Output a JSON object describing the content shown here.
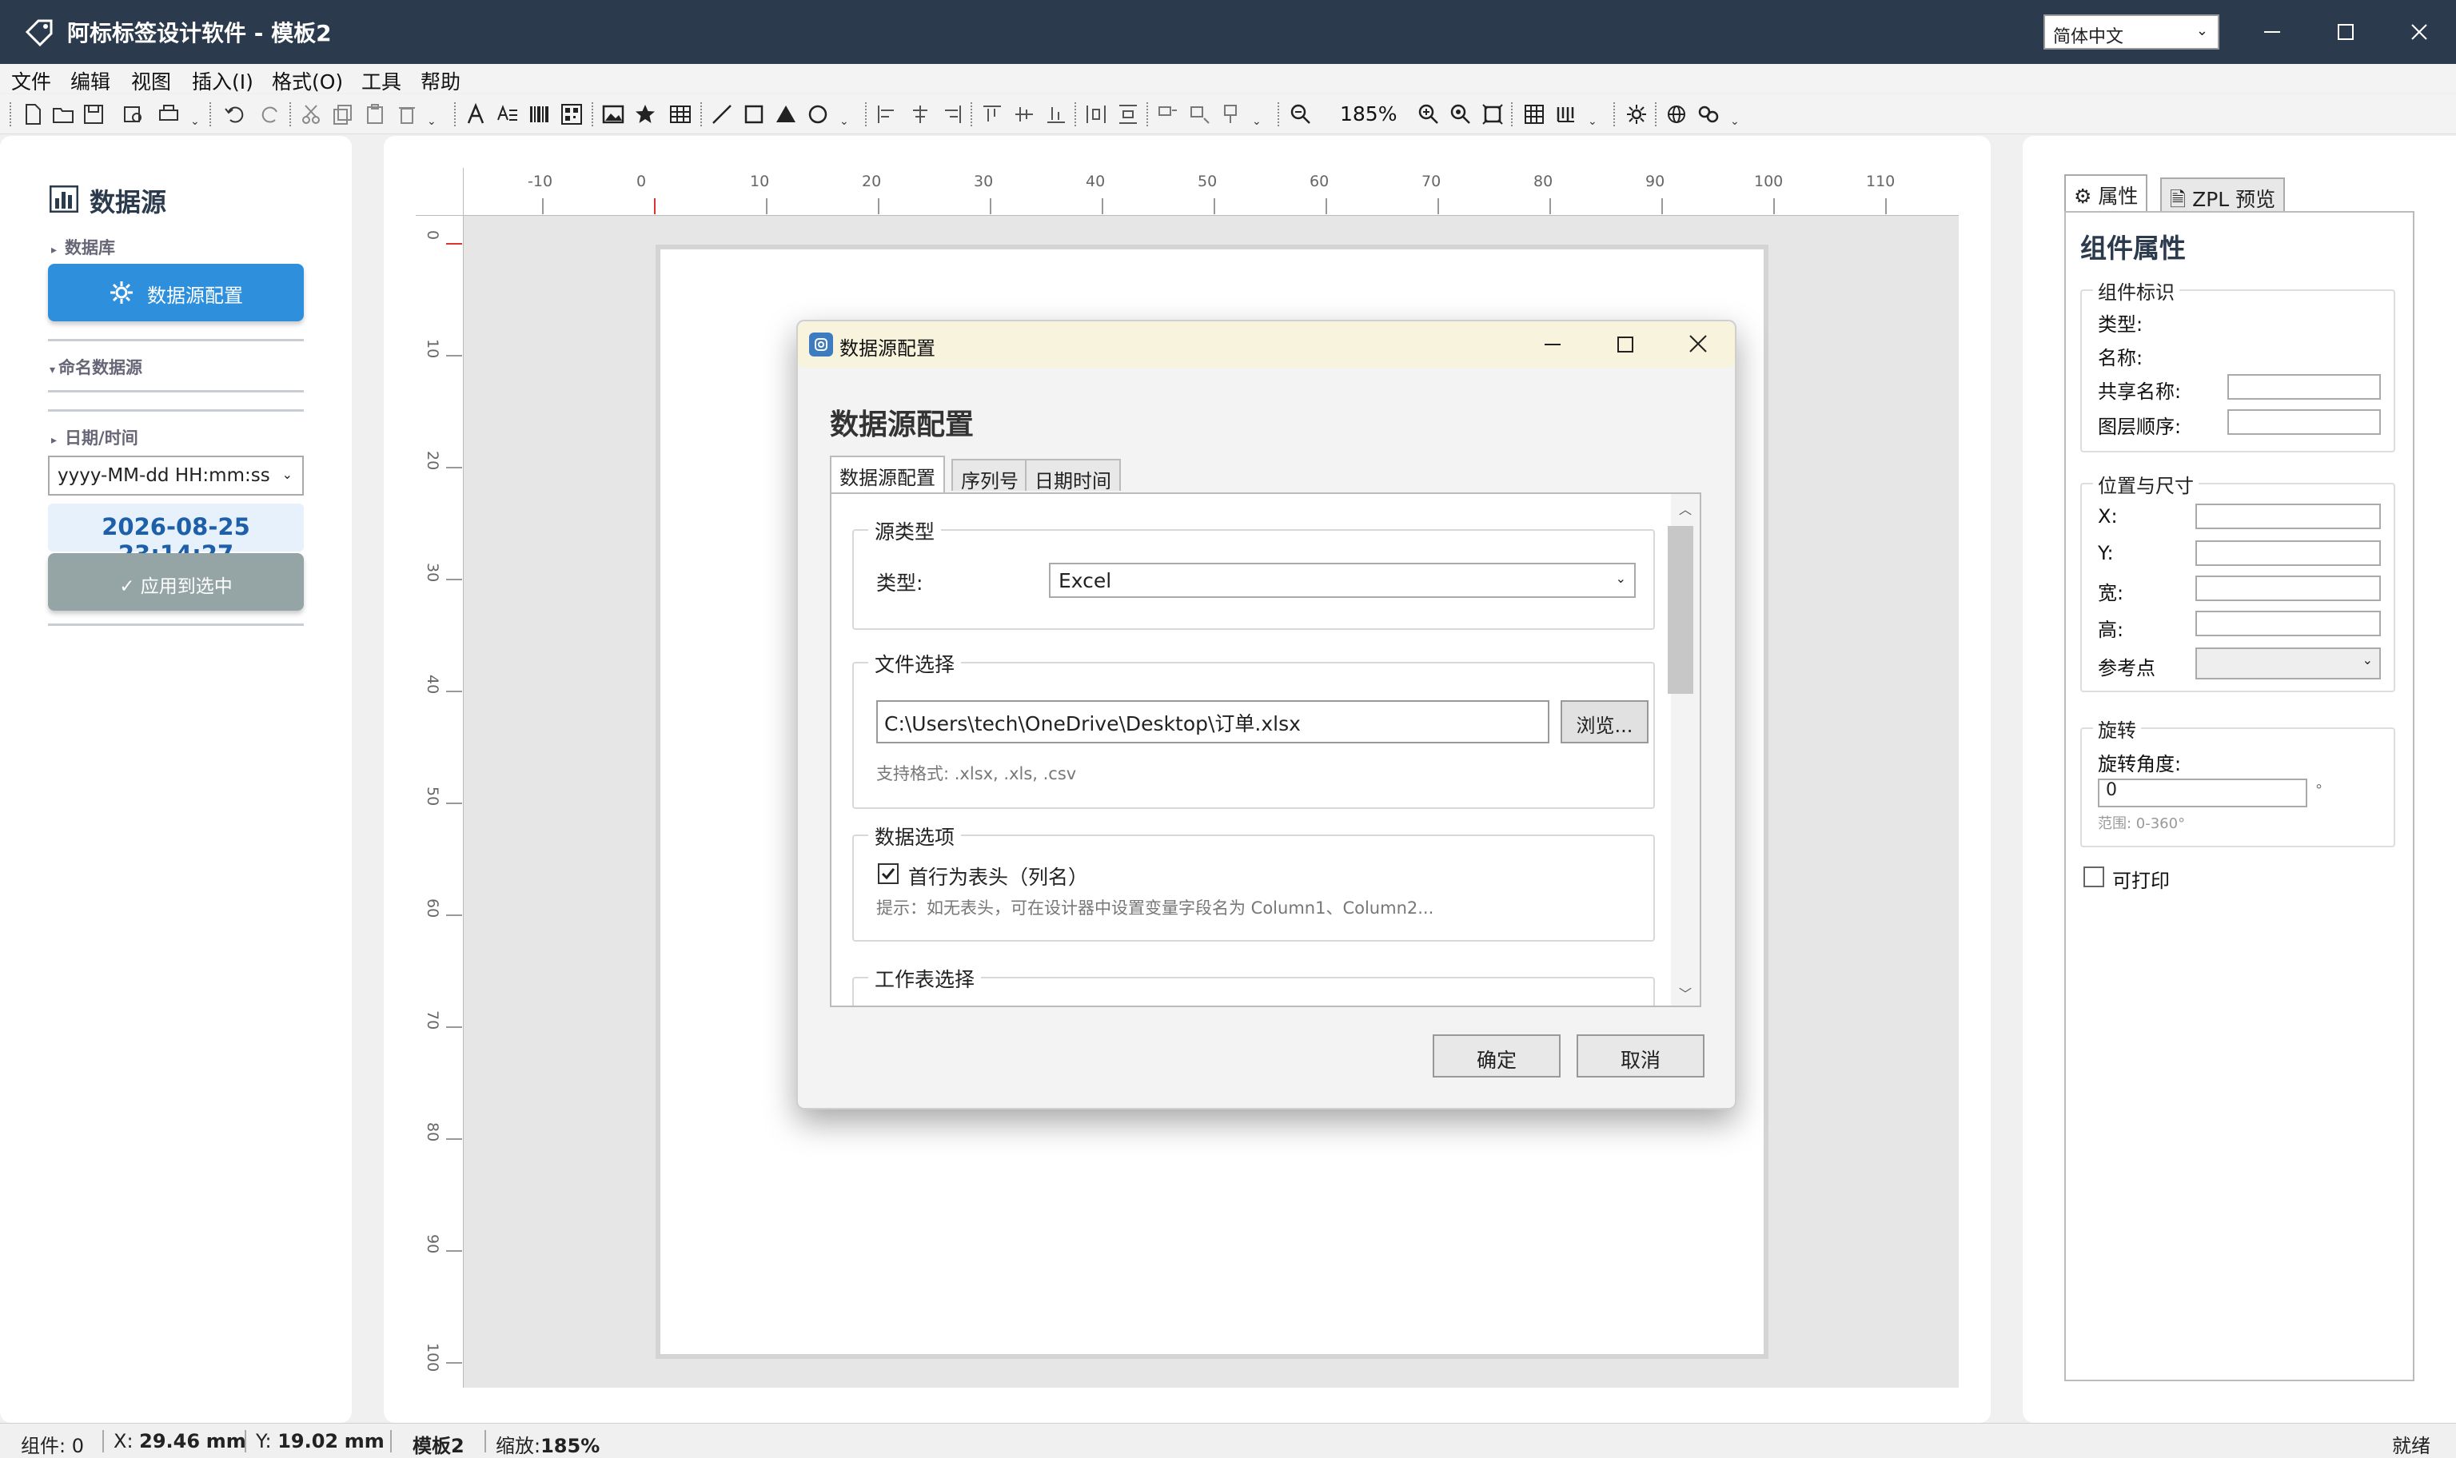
{
  "window": {
    "title": "阿标标签设计软件 - 模板2",
    "language": "简体中文"
  },
  "menu": [
    "文件",
    "编辑",
    "视图",
    "插入(I)",
    "格式(O)",
    "工具",
    "帮助"
  ],
  "toolbar": {
    "zoom": "185%"
  },
  "left_panel": {
    "title": "数据源",
    "section_database": "数据库",
    "ds_button": "数据源配置",
    "section_named": "命名数据源",
    "section_datetime": "日期/时间",
    "datetime_format": "yyyy-MM-dd HH:mm:ss",
    "datetime_value": "2026-08-25 23:14:27",
    "apply_button": "✓ 应用到选中"
  },
  "ruler": {
    "top_labels": [
      "-10",
      "0",
      "10",
      "20",
      "30",
      "40",
      "50",
      "60",
      "70",
      "80",
      "90",
      "100",
      "110"
    ],
    "left_labels": [
      "0",
      "10",
      "20",
      "30",
      "40",
      "50",
      "60",
      "70",
      "80",
      "90",
      "100"
    ]
  },
  "dialog": {
    "title": "数据源配置",
    "heading": "数据源配置",
    "tabs": [
      "数据源配置",
      "序列号",
      "日期时间"
    ],
    "source_group": "源类型",
    "type_label": "类型:",
    "type_value": "Excel",
    "file_group": "文件选择",
    "file_path": "C:\\Users\\tech\\OneDrive\\Desktop\\订单.xlsx",
    "browse_button": "浏览...",
    "file_hint": "支持格式: .xlsx, .xls, .csv",
    "data_group": "数据选项",
    "header_checkbox": "首行为表头（列名）",
    "header_checked": true,
    "data_hint": "提示：如无表头，可在设计器中设置变量字段名为 Column1、Column2...",
    "sheet_group": "工作表选择",
    "ok_button": "确定",
    "cancel_button": "取消"
  },
  "right_panel": {
    "tabs": [
      "属性",
      "ZPL 预览"
    ],
    "heading": "组件属性",
    "id_group": "组件标识",
    "type_label": "类型:",
    "name_label": "名称:",
    "shared_name_label": "共享名称:",
    "layer_label": "图层顺序:",
    "pos_group": "位置与尺寸",
    "x_label": "X:",
    "y_label": "Y:",
    "w_label": "宽:",
    "h_label": "高:",
    "ref_label": "参考点",
    "rot_group": "旋转",
    "rot_label": "旋转角度:",
    "rot_value": "0",
    "rot_unit": "°",
    "rot_hint": "范围: 0-360°",
    "printable_label": "可打印"
  },
  "status": {
    "components": "组件: 0",
    "x_prefix": "X: ",
    "x_value": "29.46",
    "x_unit": "mm",
    "y_prefix": "Y: ",
    "y_value": "19.02",
    "y_unit": "mm",
    "template": "模板2",
    "zoom_prefix": "缩放:",
    "zoom_value": "185%",
    "ready": "就绪"
  }
}
